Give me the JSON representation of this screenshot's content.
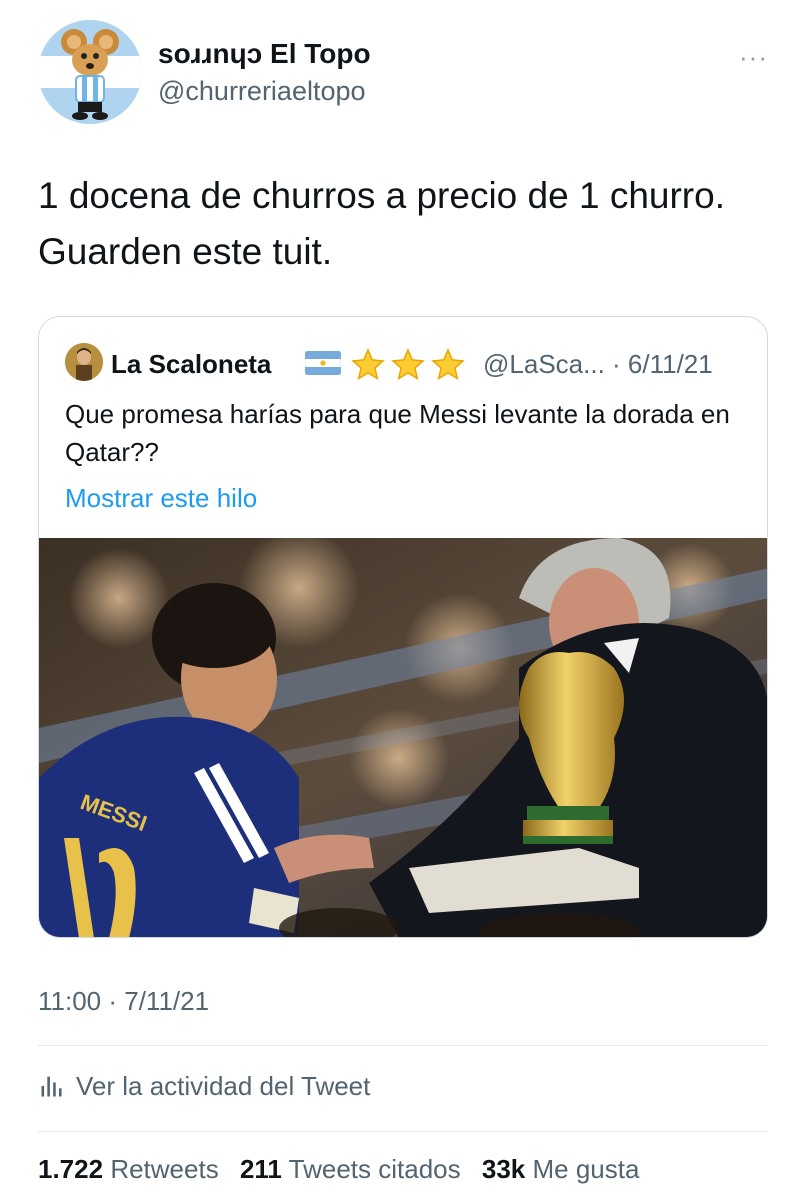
{
  "author": {
    "display_name": "soɹɹnɥɔ El Topo",
    "handle": "@churreriaeltopo",
    "avatar_icon": "cartoon-mouse-avatar-icon"
  },
  "more_icon": "···",
  "tweet": {
    "text": "1 docena de churros a precio de 1 churro. Guarden este tuit."
  },
  "quoted": {
    "display_name": "La Scaloneta",
    "handle_date": "@LaSca... · 6/11/21",
    "text": "Que promesa harías para que Messi levante la dorada en Qatar??",
    "show_thread": "Mostrar este hilo",
    "image_icon": "messi-world-cup-trophy-photo"
  },
  "meta": {
    "timestamp": "11:00 · 7/11/21"
  },
  "activity": {
    "label": "Ver la actividad del Tweet",
    "icon": "analytics-bars-icon"
  },
  "stats": {
    "retweets_count": "1.722",
    "retweets_label": "Retweets",
    "quotes_count": "211",
    "quotes_label": "Tweets citados",
    "likes_count": "33k",
    "likes_label": "Me gusta"
  },
  "colors": {
    "text": "#0f1419",
    "secondary": "#536471",
    "link": "#1d9bf0",
    "border": "#cfd9de"
  }
}
